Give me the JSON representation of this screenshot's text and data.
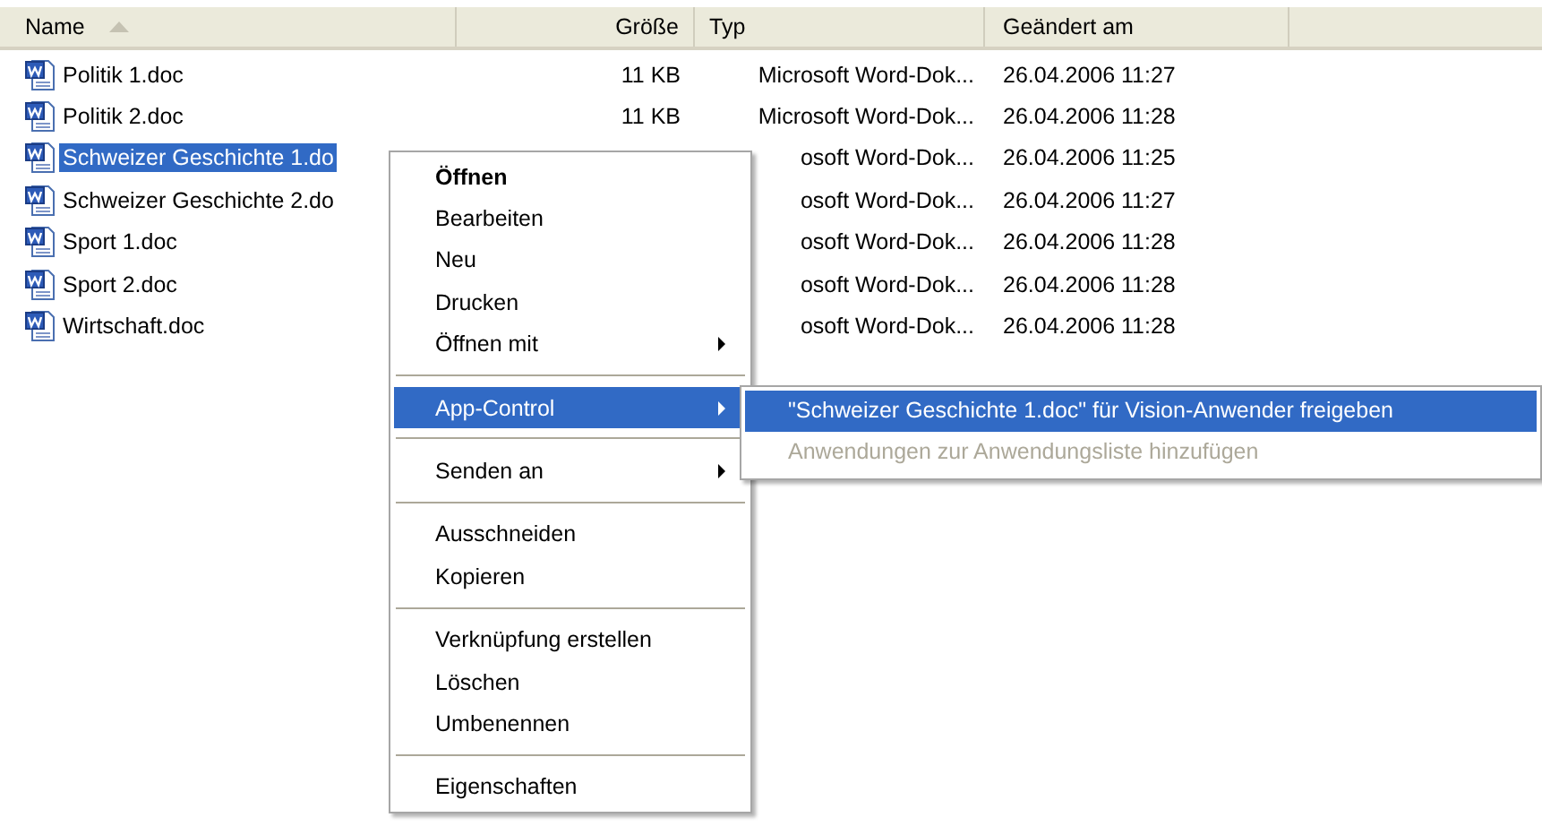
{
  "columns": [
    {
      "label": "Name",
      "sorted": true
    },
    {
      "label": "Größe",
      "sorted": false
    },
    {
      "label": "Typ",
      "sorted": false
    },
    {
      "label": "Geändert am",
      "sorted": false
    }
  ],
  "files": [
    {
      "name": "Politik 1.doc",
      "size": "11 KB",
      "type": "Microsoft Word-Dok...",
      "modified": "26.04.2006 11:27",
      "selected": false
    },
    {
      "name": "Politik 2.doc",
      "size": "11 KB",
      "type": "Microsoft Word-Dok...",
      "modified": "26.04.2006 11:28",
      "selected": false
    },
    {
      "name": "Schweizer Geschichte 1.do",
      "type": "osoft Word-Dok...",
      "modified": "26.04.2006 11:25",
      "selected": true
    },
    {
      "name": "Schweizer Geschichte 2.do",
      "type": "osoft Word-Dok...",
      "modified": "26.04.2006 11:27",
      "selected": false
    },
    {
      "name": "Sport 1.doc",
      "type": "osoft Word-Dok...",
      "modified": "26.04.2006 11:28",
      "selected": false
    },
    {
      "name": "Sport 2.doc",
      "type": "osoft Word-Dok...",
      "modified": "26.04.2006 11:28",
      "selected": false
    },
    {
      "name": "Wirtschaft.doc",
      "type": "osoft Word-Dok...",
      "modified": "26.04.2006 11:28",
      "selected": false
    }
  ],
  "context_menu": [
    {
      "kind": "item",
      "label": "Öffnen",
      "default": true,
      "selected": false,
      "has_submenu": false
    },
    {
      "kind": "item",
      "label": "Bearbeiten",
      "default": false,
      "selected": false,
      "has_submenu": false
    },
    {
      "kind": "item",
      "label": "Neu",
      "default": false,
      "selected": false,
      "has_submenu": false
    },
    {
      "kind": "item",
      "label": "Drucken",
      "default": false,
      "selected": false,
      "has_submenu": false
    },
    {
      "kind": "item",
      "label": "Öffnen mit",
      "default": false,
      "selected": false,
      "has_submenu": true
    },
    {
      "kind": "separator"
    },
    {
      "kind": "item",
      "label": "App-Control",
      "default": false,
      "selected": true,
      "has_submenu": true
    },
    {
      "kind": "separator"
    },
    {
      "kind": "item",
      "label": "Senden an",
      "default": false,
      "selected": false,
      "has_submenu": true
    },
    {
      "kind": "separator"
    },
    {
      "kind": "item",
      "label": "Ausschneiden",
      "default": false,
      "selected": false,
      "has_submenu": false
    },
    {
      "kind": "item",
      "label": "Kopieren",
      "default": false,
      "selected": false,
      "has_submenu": false
    },
    {
      "kind": "separator"
    },
    {
      "kind": "item",
      "label": "Verknüpfung erstellen",
      "default": false,
      "selected": false,
      "has_submenu": false
    },
    {
      "kind": "item",
      "label": "Löschen",
      "default": false,
      "selected": false,
      "has_submenu": false
    },
    {
      "kind": "item",
      "label": "Umbenennen",
      "default": false,
      "selected": false,
      "has_submenu": false
    },
    {
      "kind": "separator"
    },
    {
      "kind": "item",
      "label": "Eigenschaften",
      "default": false,
      "selected": false,
      "has_submenu": false
    }
  ],
  "submenu": [
    {
      "label": "\"Schweizer Geschichte 1.doc\" für Vision-Anwender freigeben",
      "selected": true,
      "disabled": false
    },
    {
      "label": "Anwendungen zur Anwendungsliste hinzufügen",
      "selected": false,
      "disabled": true
    }
  ]
}
